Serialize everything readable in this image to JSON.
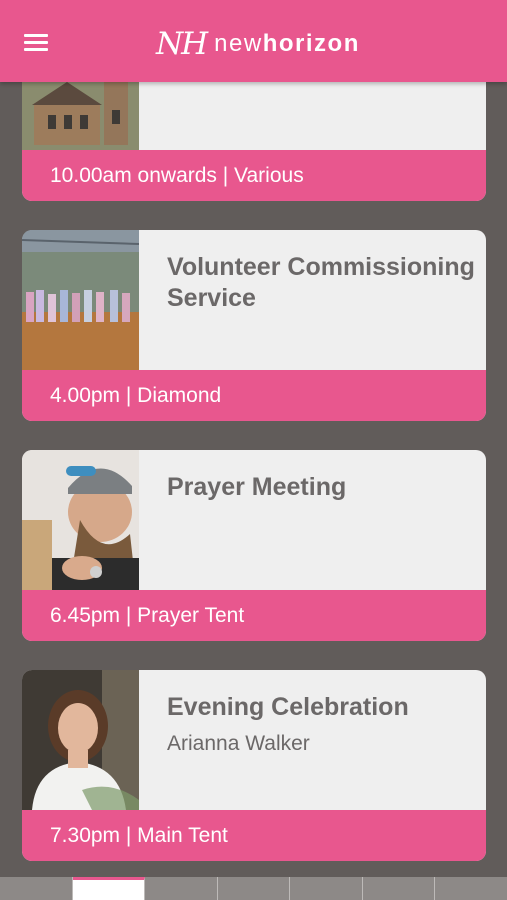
{
  "app": {
    "logo_mark": "NH",
    "logo_prefix": "new",
    "logo_bold": "horizon"
  },
  "colors": {
    "accent": "#e8578e",
    "background": "#615c5a",
    "card": "#efefef",
    "text": "#6b6868"
  },
  "events": [
    {
      "title": "",
      "subtitle": "",
      "footer": "10.00am onwards | Various",
      "image": "church-photo"
    },
    {
      "title": "Volunteer Commissioning Service",
      "subtitle": "",
      "footer": "4.00pm | Diamond",
      "image": "hall-crowd-photo"
    },
    {
      "title": "Prayer Meeting",
      "subtitle": "",
      "footer": "6.45pm | Prayer Tent",
      "image": "praying-man-photo"
    },
    {
      "title": "Evening Celebration",
      "subtitle": "Arianna Walker",
      "footer": "7.30pm | Main Tent",
      "image": "speaker-portrait-photo"
    }
  ],
  "bottom_tabs": {
    "count": 7,
    "active_index": 1
  }
}
